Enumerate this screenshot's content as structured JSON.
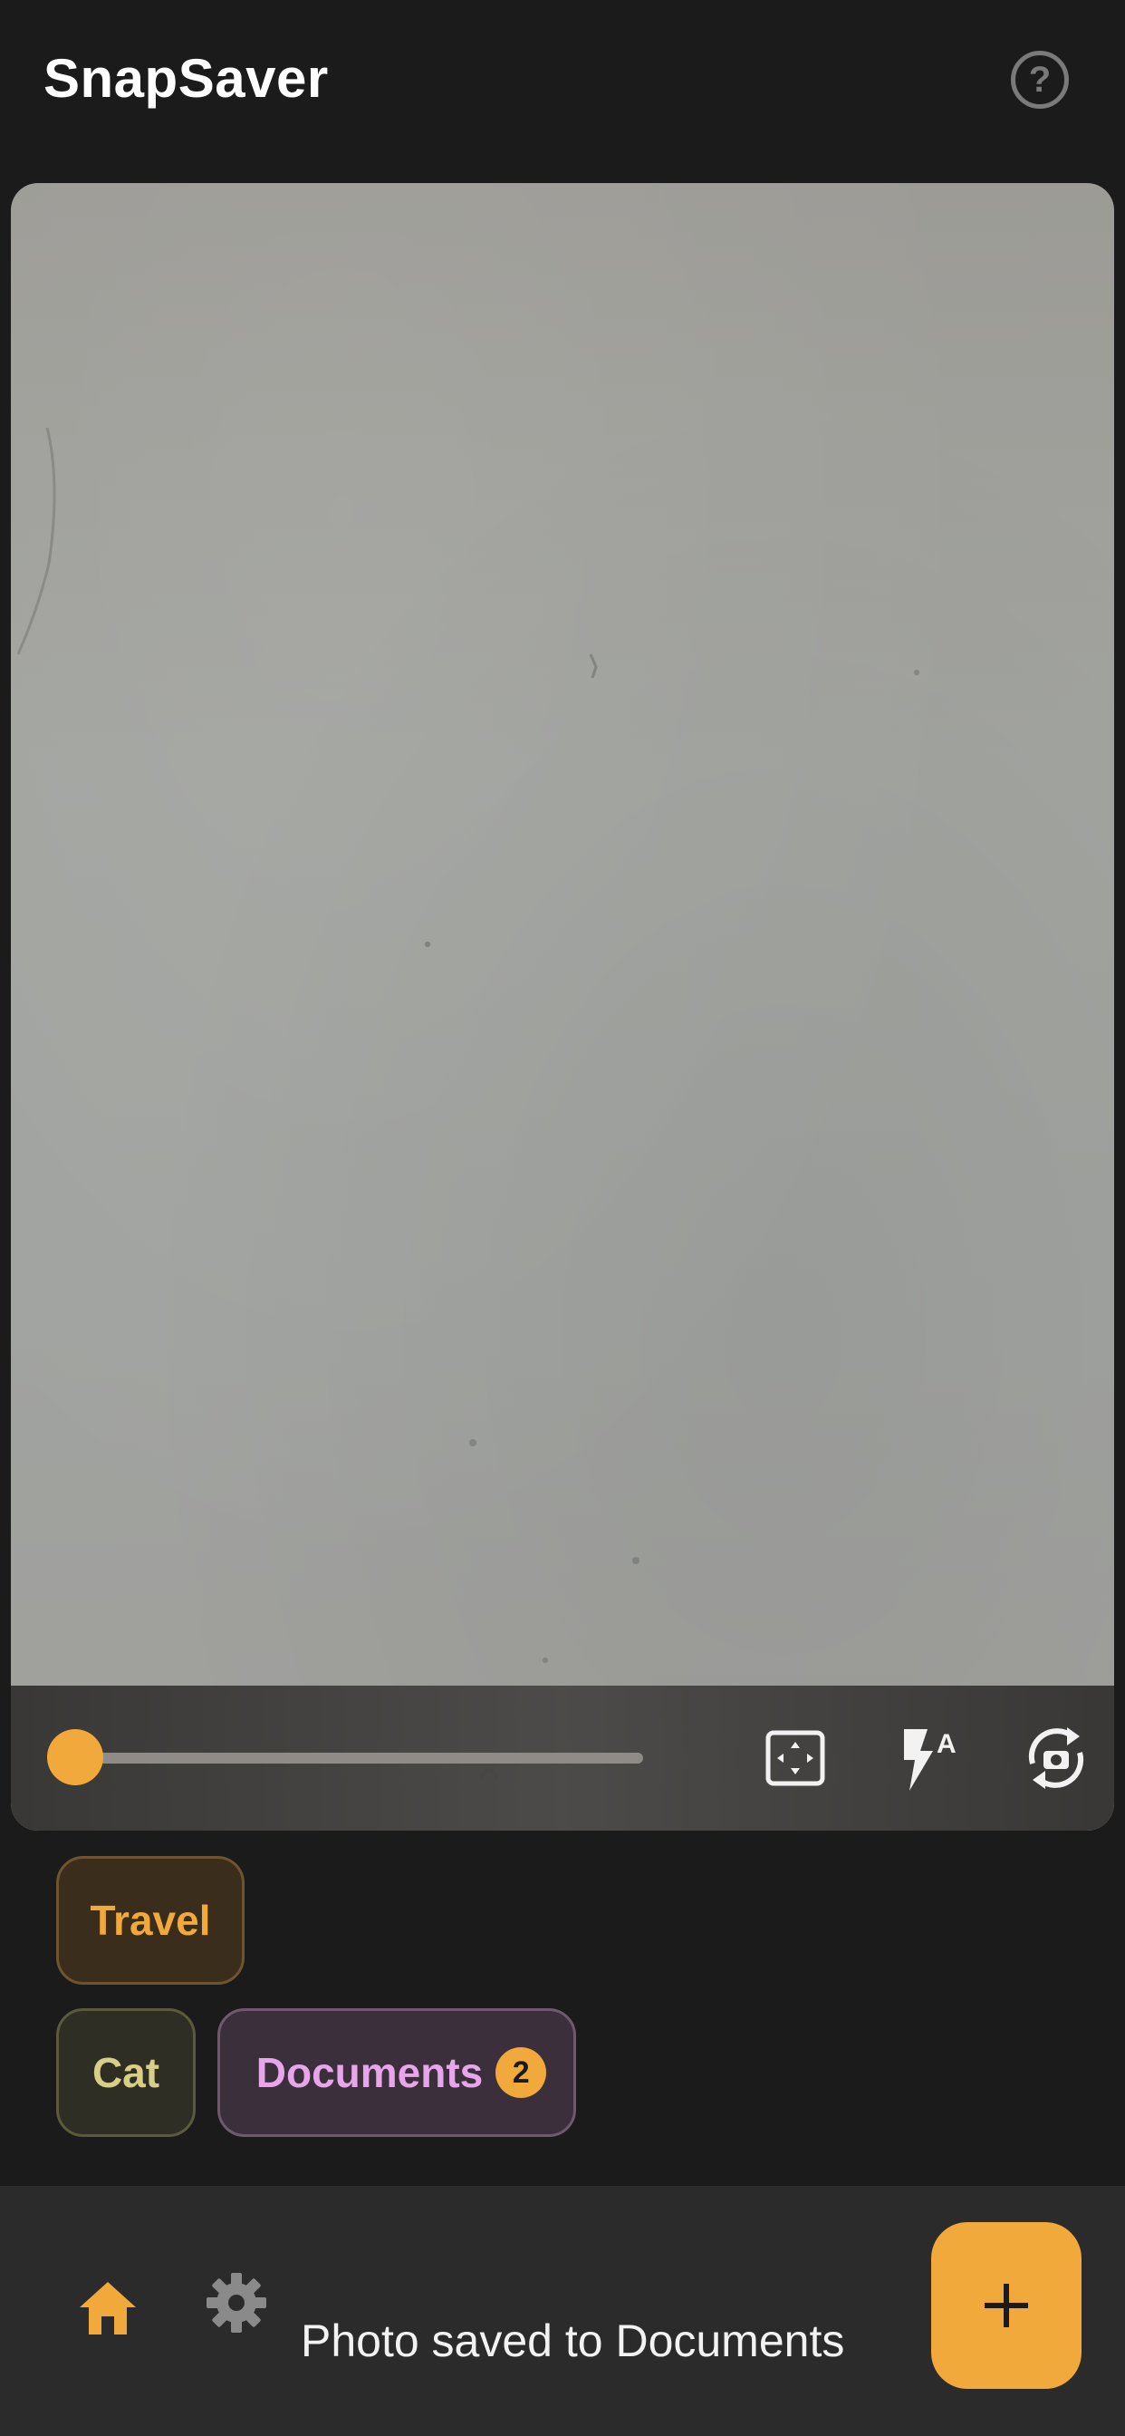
{
  "header": {
    "title": "SnapSaver",
    "help_icon": "help-circle-icon",
    "help_glyph": "?"
  },
  "camera": {
    "zoom_level": 0,
    "controls": [
      "fullscreen-icon",
      "flash-auto-icon",
      "flip-camera-icon"
    ],
    "flash_mode_label": "A"
  },
  "chips": [
    {
      "label": "Travel"
    },
    {
      "label": "Cat"
    },
    {
      "label": "Documents",
      "badge": "2"
    }
  ],
  "bottom_bar": {
    "nav": [
      "home-icon",
      "settings-icon"
    ],
    "snackbar": "Photo saved to Documents",
    "fab_icon": "plus-icon"
  },
  "colors": {
    "accent": "#f0a93a",
    "background": "#1b1b1b",
    "bottom_bar": "#2b2b2b"
  }
}
